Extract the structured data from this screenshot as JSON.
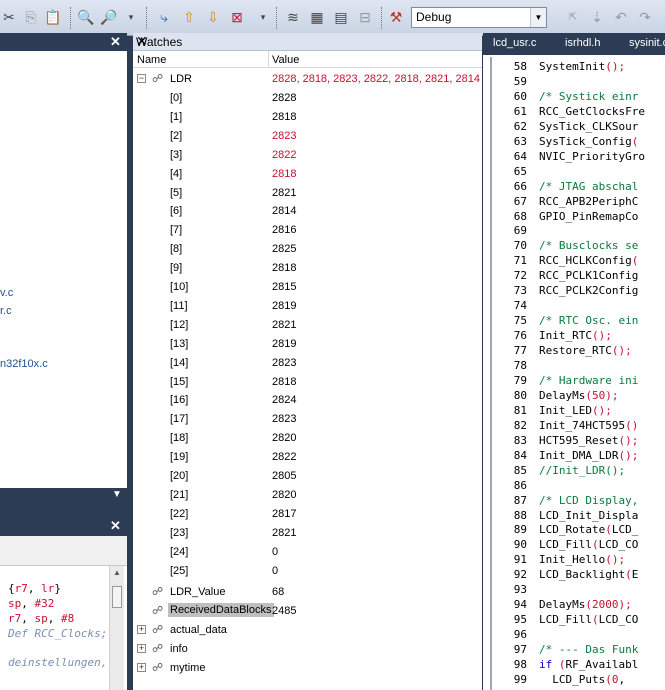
{
  "toolbar": {
    "config_value": "Debug"
  },
  "left_panel": {
    "files": [
      "v.c",
      "r.c",
      "n32f10x.c"
    ],
    "code_lines": [
      "{r7, lr}",
      "sp, #32",
      "r7, sp, #8",
      "Def RCC_Clocks;",
      "",
      "deinstellungen,"
    ]
  },
  "watches": {
    "title": "Watches",
    "col_name": "Name",
    "col_value": "Value",
    "ldr": {
      "name": "LDR",
      "value": "2828, 2818, 2823, 2822, 2818, 2821, 2814",
      "elements": [
        {
          "index": "[0]",
          "value": "2828",
          "changed": false
        },
        {
          "index": "[1]",
          "value": "2818",
          "changed": false
        },
        {
          "index": "[2]",
          "value": "2823",
          "changed": true
        },
        {
          "index": "[3]",
          "value": "2822",
          "changed": true
        },
        {
          "index": "[4]",
          "value": "2818",
          "changed": true
        },
        {
          "index": "[5]",
          "value": "2821",
          "changed": false
        },
        {
          "index": "[6]",
          "value": "2814",
          "changed": false
        },
        {
          "index": "[7]",
          "value": "2816",
          "changed": false
        },
        {
          "index": "[8]",
          "value": "2825",
          "changed": false
        },
        {
          "index": "[9]",
          "value": "2818",
          "changed": false
        },
        {
          "index": "[10]",
          "value": "2815",
          "changed": false
        },
        {
          "index": "[11]",
          "value": "2819",
          "changed": false
        },
        {
          "index": "[12]",
          "value": "2821",
          "changed": false
        },
        {
          "index": "[13]",
          "value": "2819",
          "changed": false
        },
        {
          "index": "[14]",
          "value": "2823",
          "changed": false
        },
        {
          "index": "[15]",
          "value": "2818",
          "changed": false
        },
        {
          "index": "[16]",
          "value": "2824",
          "changed": false
        },
        {
          "index": "[17]",
          "value": "2823",
          "changed": false
        },
        {
          "index": "[18]",
          "value": "2820",
          "changed": false
        },
        {
          "index": "[19]",
          "value": "2822",
          "changed": false
        },
        {
          "index": "[20]",
          "value": "2805",
          "changed": false
        },
        {
          "index": "[21]",
          "value": "2820",
          "changed": false
        },
        {
          "index": "[22]",
          "value": "2817",
          "changed": false
        },
        {
          "index": "[23]",
          "value": "2821",
          "changed": false
        },
        {
          "index": "[24]",
          "value": "0",
          "changed": false
        },
        {
          "index": "[25]",
          "value": "0",
          "changed": false
        }
      ]
    },
    "ldr_value": {
      "name": "LDR_Value",
      "value": "68"
    },
    "received": {
      "name": "ReceivedDataBlocks",
      "value": "2485"
    },
    "collapsed": [
      "actual_data",
      "info",
      "mytime"
    ]
  },
  "code": {
    "tabs": [
      "lcd_usr.c",
      "isrhdl.h",
      "sysinit.c"
    ],
    "lines": [
      {
        "n": "58",
        "t": "SystemInit();"
      },
      {
        "n": "59",
        "t": ""
      },
      {
        "n": "60",
        "t": "/* Systick einr"
      },
      {
        "n": "61",
        "t": "RCC_GetClocksFre"
      },
      {
        "n": "62",
        "t": "SysTick_CLKSour"
      },
      {
        "n": "63",
        "t": "SysTick_Config("
      },
      {
        "n": "64",
        "t": "NVIC_PriorityGro"
      },
      {
        "n": "65",
        "t": ""
      },
      {
        "n": "66",
        "t": "/* JTAG abschal"
      },
      {
        "n": "67",
        "t": "RCC_APB2PeriphC"
      },
      {
        "n": "68",
        "t": "GPIO_PinRemapCo"
      },
      {
        "n": "69",
        "t": ""
      },
      {
        "n": "70",
        "t": "/* Busclocks se"
      },
      {
        "n": "71",
        "t": "RCC_HCLKConfig("
      },
      {
        "n": "72",
        "t": "RCC_PCLK1Config"
      },
      {
        "n": "73",
        "t": "RCC_PCLK2Config"
      },
      {
        "n": "74",
        "t": ""
      },
      {
        "n": "75",
        "t": "/* RTC Osc. ein"
      },
      {
        "n": "76",
        "t": "Init_RTC();"
      },
      {
        "n": "77",
        "t": "Restore_RTC();"
      },
      {
        "n": "78",
        "t": ""
      },
      {
        "n": "79",
        "t": "/* Hardware ini"
      },
      {
        "n": "80",
        "t": "DelayMs(50);"
      },
      {
        "n": "81",
        "t": "Init_LED();"
      },
      {
        "n": "82",
        "t": "Init_74HCT595()"
      },
      {
        "n": "83",
        "t": "HCT595_Reset();"
      },
      {
        "n": "84",
        "t": "Init_DMA_LDR();"
      },
      {
        "n": "85",
        "t": "//Init_LDR();"
      },
      {
        "n": "86",
        "t": ""
      },
      {
        "n": "87",
        "t": "/* LCD Display,"
      },
      {
        "n": "88",
        "t": "LCD_Init_Displa"
      },
      {
        "n": "89",
        "t": "LCD_Rotate(LCD_"
      },
      {
        "n": "90",
        "t": "LCD_Fill(LCD_CO"
      },
      {
        "n": "91",
        "t": "Init_Hello();"
      },
      {
        "n": "92",
        "t": "LCD_Backlight(E"
      },
      {
        "n": "93",
        "t": ""
      },
      {
        "n": "94",
        "t": "DelayMs(2000);"
      },
      {
        "n": "95",
        "t": "LCD_Fill(LCD_CO"
      },
      {
        "n": "96",
        "t": ""
      },
      {
        "n": "97",
        "t": "/* --- Das Funk"
      },
      {
        "n": "98",
        "t": "if (RF_Availabl"
      },
      {
        "n": "99",
        "t": "  LCD_Puts(0,"
      }
    ]
  }
}
